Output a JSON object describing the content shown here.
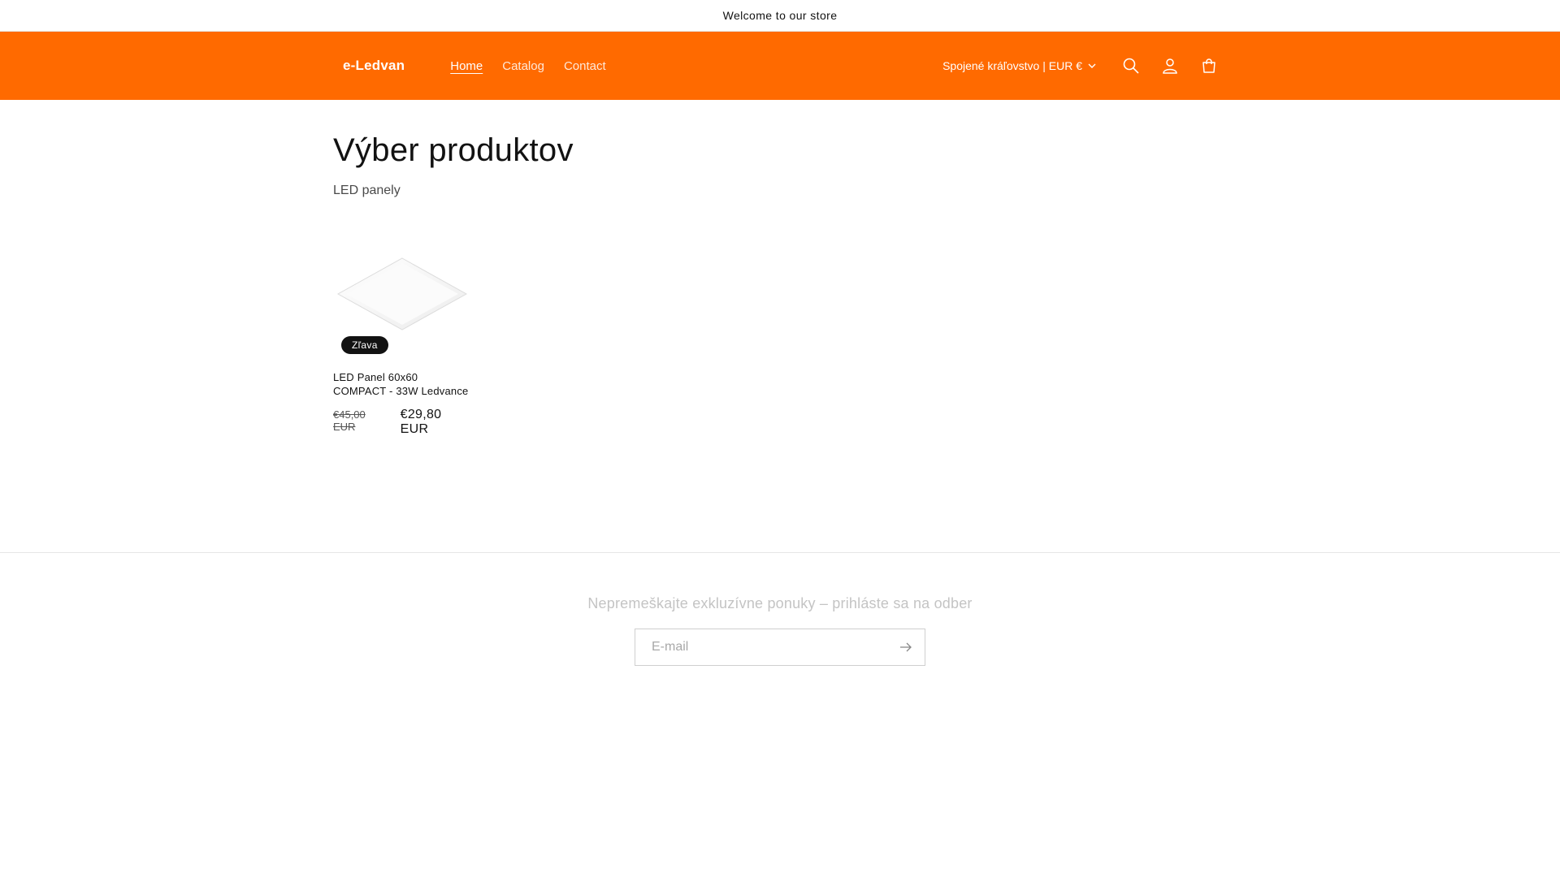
{
  "announcement": {
    "text": "Welcome to our store"
  },
  "header": {
    "logo": "e-Ledvan",
    "nav": [
      {
        "label": "Home",
        "active": true
      },
      {
        "label": "Catalog",
        "active": false
      },
      {
        "label": "Contact",
        "active": false
      }
    ],
    "country_selector": "Spojené kráľovstvo | EUR €",
    "icons": [
      "search-icon",
      "account-icon",
      "cart-icon"
    ]
  },
  "main": {
    "title": "Výber produktov",
    "subtitle": "LED panely",
    "products": [
      {
        "title": "LED Panel 60x60 COMPACT - 33W Ledvance",
        "badge": "Zľava",
        "price_old": "€45,00 EUR",
        "price_new": "€29,80 EUR"
      }
    ]
  },
  "footer": {
    "newsletter_title": "Nepremeškajte exkluzívne ponuky – prihláste sa na odber",
    "email_placeholder": "E-mail"
  },
  "colors": {
    "header_bg": "#ff6a00",
    "text": "#121212",
    "badge_bg": "#121212"
  }
}
